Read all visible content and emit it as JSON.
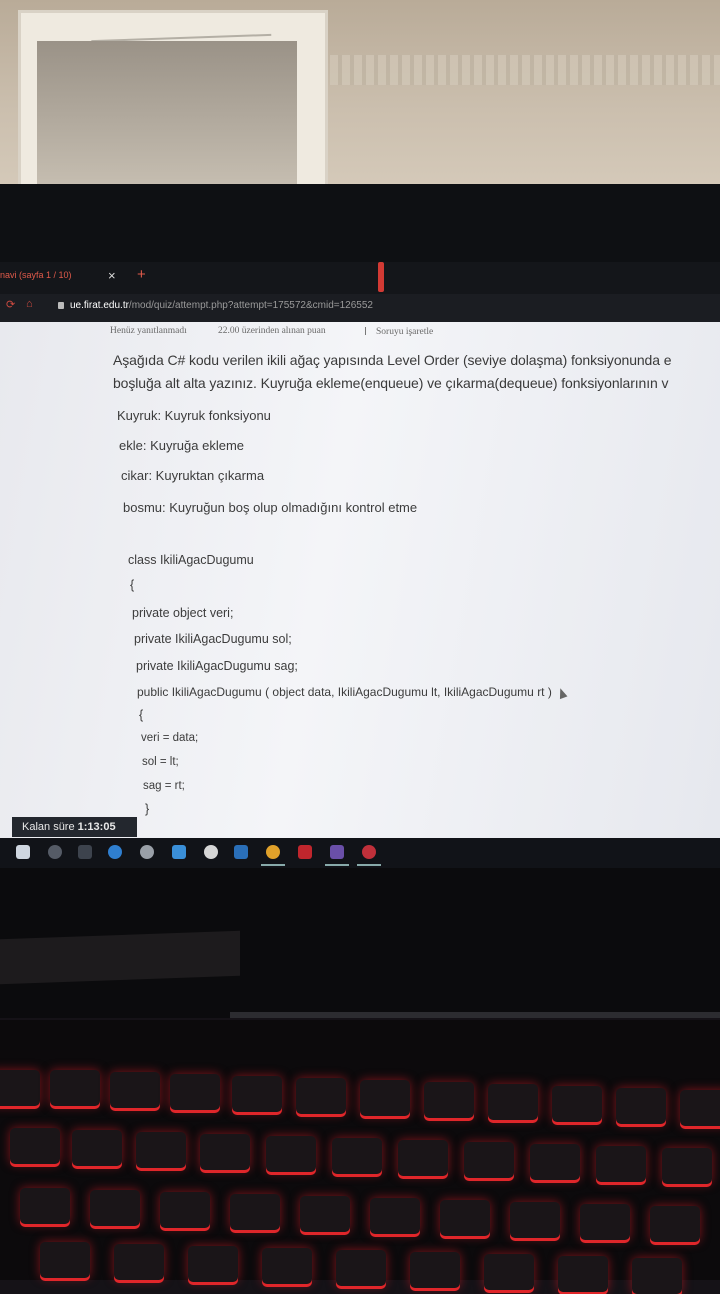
{
  "browser": {
    "tab_title": "navi (sayfa 1 / 10)",
    "tab_close": "×",
    "new_tab": "+",
    "url_host": "ue.firat.edu.tr",
    "url_path": "/mod/quiz/attempt.php?attempt=175572&cmid=126552"
  },
  "question_meta": {
    "status": "Henüz yanıtlanmadı",
    "points": "22.00 üzerinden alınan puan",
    "flag": "Soruyu işaretle"
  },
  "question": {
    "line1": "Aşağıda C# kodu verilen ikili ağaç yapısında Level Order (seviye dolaşma) fonksiyonunda e",
    "line2": "boşluğa alt alta yazınız. Kuyruğa ekleme(enqueue) ve çıkarma(dequeue) fonksiyonlarının v"
  },
  "definitions": [
    "Kuyruk: Kuyruk fonksiyonu",
    "ekle: Kuyruğa ekleme",
    "cikar: Kuyruktan çıkarma",
    "bosmu: Kuyruğun boş olup olmadığını kontrol etme"
  ],
  "code_lines": [
    "class IkiliAgacDugumu",
    "{",
    "private object veri;",
    "private IkiliAgacDugumu  sol;",
    "private IkiliAgacDugumu  sag;",
    "public IkiliAgacDugumu ( object data, IkiliAgacDugumu  lt, IkiliAgacDugumu  rt )",
    "{",
    "veri = data;",
    "sol = lt;",
    "sag = rt;",
    "}"
  ],
  "timer": {
    "label": "Kalan süre",
    "value": "1:13:05"
  },
  "colors": {
    "keyboard_backlight": "#e0262a",
    "accent_red": "#d23a34"
  }
}
